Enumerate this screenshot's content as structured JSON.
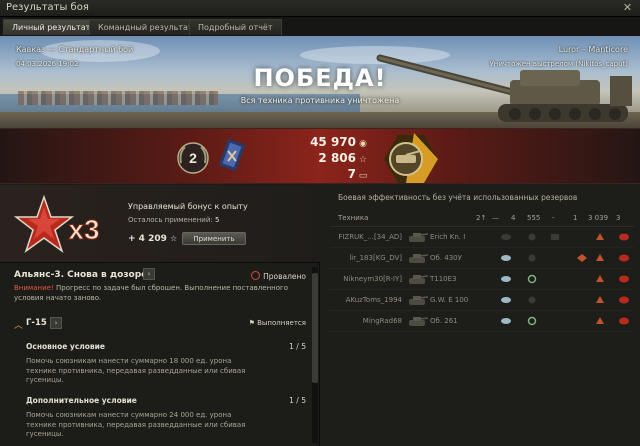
{
  "window": {
    "title": "Результаты боя",
    "close_glyph": "✕"
  },
  "tabs": [
    {
      "label": "Личный результат",
      "active": true
    },
    {
      "label": "Командный результат",
      "active": false
    },
    {
      "label": "Подробный отчёт",
      "active": false
    }
  ],
  "battle": {
    "map": "Кавказ — Стандартный бой",
    "date": "04.03.2026 19:02",
    "player": "Luror – Manticore",
    "killed_by": "Уничтожен выстрелом (Nikitos_caput)",
    "result": "ПОБЕДА!",
    "result_sub": "Вся техника противника уничтожена"
  },
  "results": {
    "rank": "2",
    "credits": "45 970",
    "xp": "2 806",
    "free_xp": "7",
    "credits_icon": "credits-icon",
    "xp_icon": "xp-star-icon",
    "free_xp_icon": "free-xp-icon"
  },
  "bonus": {
    "multiplier": "x3",
    "title": "Управляемый бонус к опыту",
    "remaining_label": "Осталось применений:",
    "remaining_value": "5",
    "xp_value": "+ 4 209",
    "apply_label": "Применить"
  },
  "mission": {
    "title": "Альянс-3. Снова в дозоре",
    "status": "Провалено",
    "warning_label": "Внимание!",
    "warning_text": "Прогресс по задаче был сброшен. Выполнение поставленного условия начато заново.",
    "sub_name": "Г-15",
    "sub_status": "Выполняется",
    "conditions": [
      {
        "title": "Основное условие",
        "count": "1 / 5",
        "desc": "Помочь союзникам нанести суммарно 18 000 ед. урона технике противника, передавая разведданные или сбивая гусеницы."
      },
      {
        "title": "Дополнительное условие",
        "count": "1 / 5",
        "desc": "Помочь союзникам нанести суммарно 24 000 ед. урона технике противника, передавая разведданные или сбивая гусеницы."
      }
    ]
  },
  "efficiency": {
    "title": "Боевая эффективность без учёта использованных резервов",
    "headers": [
      "Техника",
      "2↑",
      "—",
      "4",
      "555",
      "-",
      "1",
      "3 039",
      "3"
    ],
    "rows": [
      {
        "player": "FIZRUK_...[34_AD]",
        "tank": "Erich Kn. I"
      },
      {
        "player": "lir_183[KG_DV]",
        "tank": "Об. 430У"
      },
      {
        "player": "Nikneym30[R-IY]",
        "tank": "T110E3"
      },
      {
        "player": "AKuzToms_1994",
        "tank": "G.W. E 100"
      },
      {
        "player": "MingRad68",
        "tank": "Об. 261"
      }
    ],
    "accent_red": "#c0392b",
    "accent_orange": "#d9792b"
  }
}
